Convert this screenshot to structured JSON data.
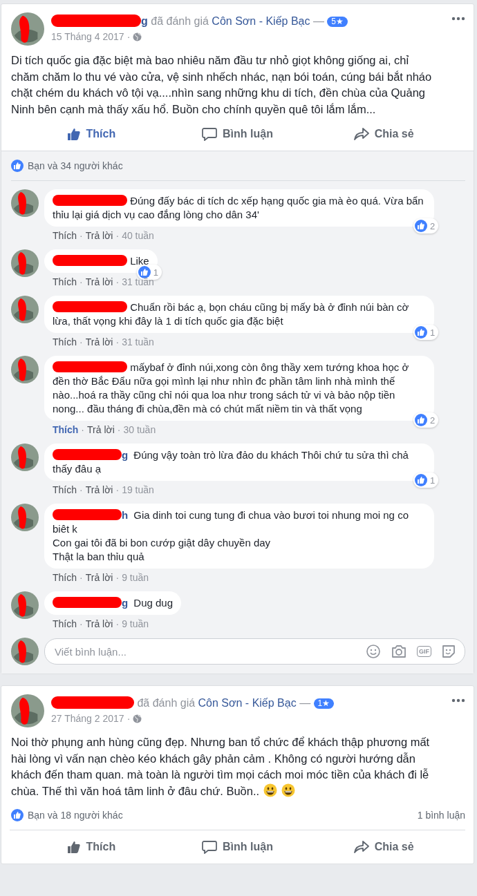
{
  "separator": "·",
  "posts": [
    {
      "name_tail": "g",
      "action": "đã đánh giá",
      "page": "Côn Sơn - Kiếp Bạc",
      "dash": "—",
      "rating": "5★",
      "date": "15 Tháng 4 2017",
      "liked": true,
      "text": "Di tích quốc gia đặc biệt mà bao nhiêu năm đầu tư nhỏ giọt không giống ai, chỉ chăm chăm lo thu vé vào cửa, vệ sinh nhếch nhác, nạn bói toán, cúng bái bắt nháo chặt chém du khách vô tội vạ....nhìn sang những khu di tích, đền chùa của Quảng Ninh bên cạnh mà thấy xấu hổ. Buồn cho chính quyền quê tôi lắm lắm...",
      "actions": [
        {
          "kind": "like",
          "label": "Thích"
        },
        {
          "kind": "comment",
          "label": "Bình luận"
        },
        {
          "kind": "share",
          "label": "Chia sẻ"
        }
      ],
      "reactions": "Bạn và 34 người khác",
      "comments": [
        {
          "text": "Đúng đấy bác di tích dc xếp hạng quốc gia mà èo quá. Vừa bẩn thỉu lại giá dịch vụ cao đắng lòng cho dân 34'",
          "liked": false,
          "likes": "2",
          "meta": [
            "Thích",
            "Trả lời",
            "40 tuần"
          ]
        },
        {
          "text": "Like",
          "liked": false,
          "likes": "1",
          "meta": [
            "Thích",
            "Trả lời",
            "31 tuần"
          ]
        },
        {
          "text": "Chuẩn rồi bác ạ, bọn cháu cũng bị mấy bà ở đỉnh núi bàn cờ lừa, thất vọng khi đây là 1 di tích quốc gia đặc biệt",
          "liked": false,
          "likes": "1",
          "meta": [
            "Thích",
            "Trả lời",
            "31 tuần"
          ]
        },
        {
          "text": "mấybaf ở đỉnh núi,xong còn ông thầy xem tướng khoa học ở đền thờ Bắc Đẩu nữa gọi mình lại như nhìn đc phần tâm linh nhà mình thế nào...hoá ra thầy cũng chỉ nói qua loa như trong sách tử vi và bảo nộp tiền nong... đầu tháng đi chùa,đền mà có chút mất niềm tin và thất vọng",
          "liked": true,
          "likes": "2",
          "meta": [
            "Thích",
            "Trả lời",
            "30 tuần"
          ]
        },
        {
          "name_tail": "g",
          "text": "Đúng vậy toàn trò lừa đảo du khách Thôi chứ tu sửa thì chả thấy đâu ạ",
          "liked": false,
          "likes": "1",
          "meta": [
            "Thích",
            "Trả lời",
            "19 tuần"
          ]
        },
        {
          "name_tail": "h",
          "text": "Gia dinh toi cung tung đi chua vào bươi toi nhung moi ng co biêt k\nCon gai tôi đã bi bon cướp giật dây chuyền day\nThật la ban thỉu quả",
          "liked": false,
          "meta": [
            "Thích",
            "Trả lời",
            "9 tuần"
          ]
        },
        {
          "name_tail": "g",
          "text": "Dug dug",
          "liked": false,
          "meta": [
            "Thích",
            "Trả lời",
            "9 tuần"
          ]
        }
      ],
      "composer": {
        "placeholder": "Viết bình luận...",
        "tools": [
          {
            "kind": "emoji"
          },
          {
            "kind": "camera"
          },
          {
            "kind": "gif",
            "label": "GIF"
          },
          {
            "kind": "sticker"
          }
        ]
      }
    },
    {
      "action": "đã đánh giá",
      "page": "Côn Sơn - Kiếp Bạc",
      "dash": "—",
      "rating": "1★",
      "date": "27 Tháng 2 2017",
      "liked": false,
      "text": "Noi thờ phụng anh hùng cũng đẹp. Nhưng ban tổ chức để khách thập phương mất hài lòng vì vấn nạn chèo kéo khách gây phản cảm . Không có người hướng dẫn khách đến tham quan. mà toàn là người tìm mọi cách moi móc tiền của khách đi lễ chùa. Thế thì văn hoá tâm linh ở đâu chứ. Buồn..",
      "emojis": [
        {
          "kind": "grin"
        },
        {
          "kind": "grin"
        }
      ],
      "reactions": "Bạn và 18 người khác",
      "comment_count": "1 bình luận",
      "actions": [
        {
          "kind": "like",
          "label": "Thích"
        },
        {
          "kind": "comment",
          "label": "Bình luận"
        },
        {
          "kind": "share",
          "label": "Chia sẻ"
        }
      ]
    }
  ]
}
